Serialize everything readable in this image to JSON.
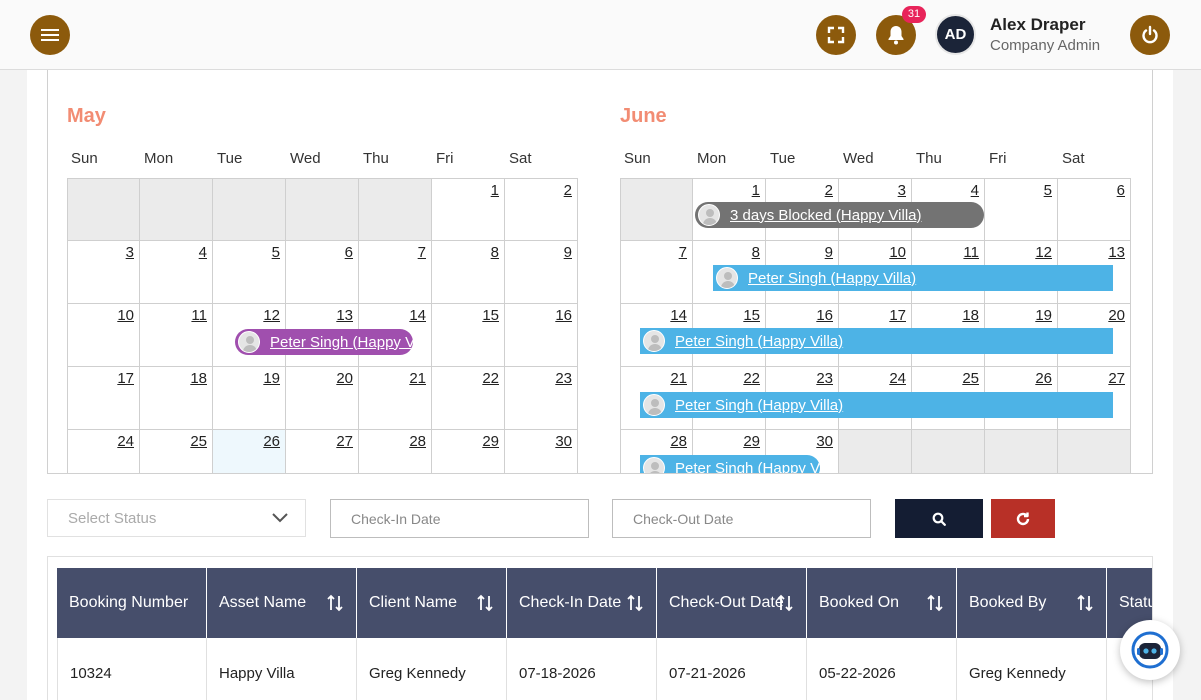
{
  "header": {
    "notification_count": "31",
    "avatar_initials": "AD",
    "user_name": "Alex Draper",
    "user_role": "Company Admin",
    "icons": [
      "hamburger-menu-icon",
      "fullscreen-icon",
      "bell-icon",
      "power-icon"
    ],
    "accent_color": "#8c5a0c"
  },
  "calendar": {
    "weekdays": [
      "Sun",
      "Mon",
      "Tue",
      "Wed",
      "Thu",
      "Fri",
      "Sat"
    ],
    "months": [
      {
        "name": "May",
        "cells": [
          "",
          "",
          "",
          "",
          "",
          "1",
          "2",
          "3",
          "4",
          "5",
          "6",
          "7",
          "8",
          "9",
          "10",
          "11",
          "12",
          "13",
          "14",
          "15",
          "16",
          "17",
          "18",
          "19",
          "20",
          "21",
          "22",
          "23",
          "24",
          "25",
          "26",
          "27",
          "28",
          "29",
          "30"
        ],
        "today": "26",
        "events": [
          {
            "label": "Peter Singh (Happy Villa)",
            "color": "#a04fae",
            "start_day": "12",
            "end_day": "13"
          }
        ]
      },
      {
        "name": "June",
        "cells": [
          "",
          "1",
          "2",
          "3",
          "4",
          "5",
          "6",
          "7",
          "8",
          "9",
          "10",
          "11",
          "12",
          "13",
          "14",
          "15",
          "16",
          "17",
          "18",
          "19",
          "20",
          "21",
          "22",
          "23",
          "24",
          "25",
          "26",
          "27",
          "28",
          "29",
          "30",
          "",
          "",
          "",
          ""
        ],
        "events": [
          {
            "label": "3 days Blocked (Happy Villa)",
            "color": "#737373",
            "start_day": "1",
            "end_day": "4"
          },
          {
            "label": "Peter Singh (Happy Villa)",
            "color": "#4db3e6",
            "start_day": "8",
            "end_day": "13"
          },
          {
            "label": "Peter Singh (Happy Villa)",
            "color": "#4db3e6",
            "start_day": "14",
            "end_day": "20"
          },
          {
            "label": "Peter Singh (Happy Villa)",
            "color": "#4db3e6",
            "start_day": "21",
            "end_day": "27"
          },
          {
            "label": "Peter Singh (Happy Villa)",
            "color": "#4db3e6",
            "start_day": "28",
            "end_day": "30"
          }
        ]
      }
    ]
  },
  "filters": {
    "status_placeholder": "Select Status",
    "checkin_placeholder": "Check-In Date",
    "checkout_placeholder": "Check-Out Date",
    "search_icon": "search-icon",
    "reset_icon": "refresh-icon"
  },
  "table": {
    "headers": [
      "Booking Number",
      "Asset Name",
      "Client Name",
      "Check-In Date",
      "Check-Out Date",
      "Booked On",
      "Booked By",
      "Status"
    ],
    "rows": [
      [
        "10324",
        "Happy Villa",
        "Greg Kennedy",
        "07-18-2026",
        "07-21-2026",
        "05-22-2026",
        "Greg Kennedy",
        ""
      ]
    ]
  },
  "chat": {
    "icon": "chat-bot-icon"
  }
}
